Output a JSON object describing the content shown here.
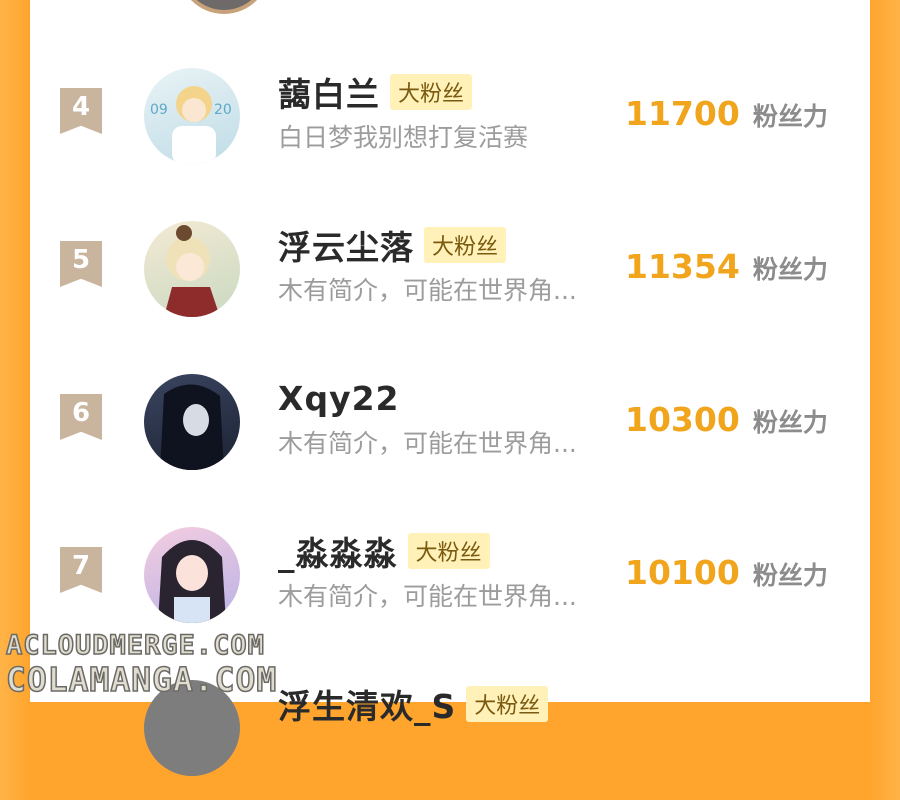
{
  "list": {
    "items": [
      {
        "rank": "4",
        "name": "藹白兰",
        "badge": "大粉丝",
        "bio": "白日梦我别想打复活赛",
        "score": "11700",
        "unit": "粉丝力"
      },
      {
        "rank": "5",
        "name": "浮云尘落",
        "badge": "大粉丝",
        "bio": "木有简介，可能在世界角...",
        "score": "11354",
        "unit": "粉丝力"
      },
      {
        "rank": "6",
        "name": "Xqy22",
        "badge": "",
        "bio": "木有简介，可能在世界角...",
        "score": "10300",
        "unit": "粉丝力"
      },
      {
        "rank": "7",
        "name": "_淼淼淼",
        "badge": "大粉丝",
        "bio": "木有简介，可能在世界角...",
        "score": "10100",
        "unit": "粉丝力"
      },
      {
        "rank": "",
        "name": "浮生清欢_S",
        "badge": "大粉丝",
        "bio": "",
        "score": "",
        "unit": ""
      }
    ],
    "avatar_colors": [
      "#cfe6ee",
      "#f0d2a8",
      "#2c3346",
      "#e7c6de",
      "#8a8a8a"
    ]
  },
  "watermark": {
    "line1": "ACLOUDMERGE.COM",
    "line2": "COLAMANGA.COM"
  }
}
